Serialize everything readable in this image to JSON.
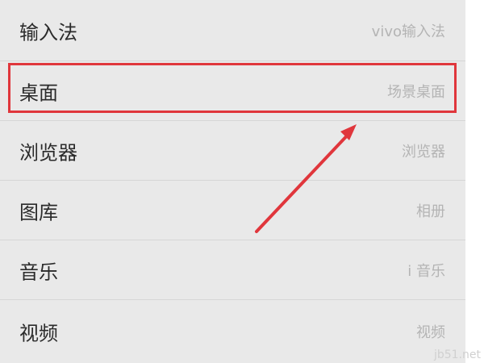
{
  "settings": {
    "rows": [
      {
        "label": "输入法",
        "value": "vivo输入法"
      },
      {
        "label": "桌面",
        "value": "场景桌面"
      },
      {
        "label": "浏览器",
        "value": "浏览器"
      },
      {
        "label": "图库",
        "value": "相册"
      },
      {
        "label": "音乐",
        "value": "i 音乐"
      },
      {
        "label": "视频",
        "value": "视频"
      }
    ]
  },
  "annotation": {
    "highlight_color": "#e0363c",
    "highlighted_row": "桌面"
  },
  "watermark": "jb51.net",
  "colors": {
    "panel_background": "#e9e9e9",
    "label_text": "#2b2b2b",
    "value_text": "#b4b4b4",
    "divider": "#d6d6d6"
  }
}
